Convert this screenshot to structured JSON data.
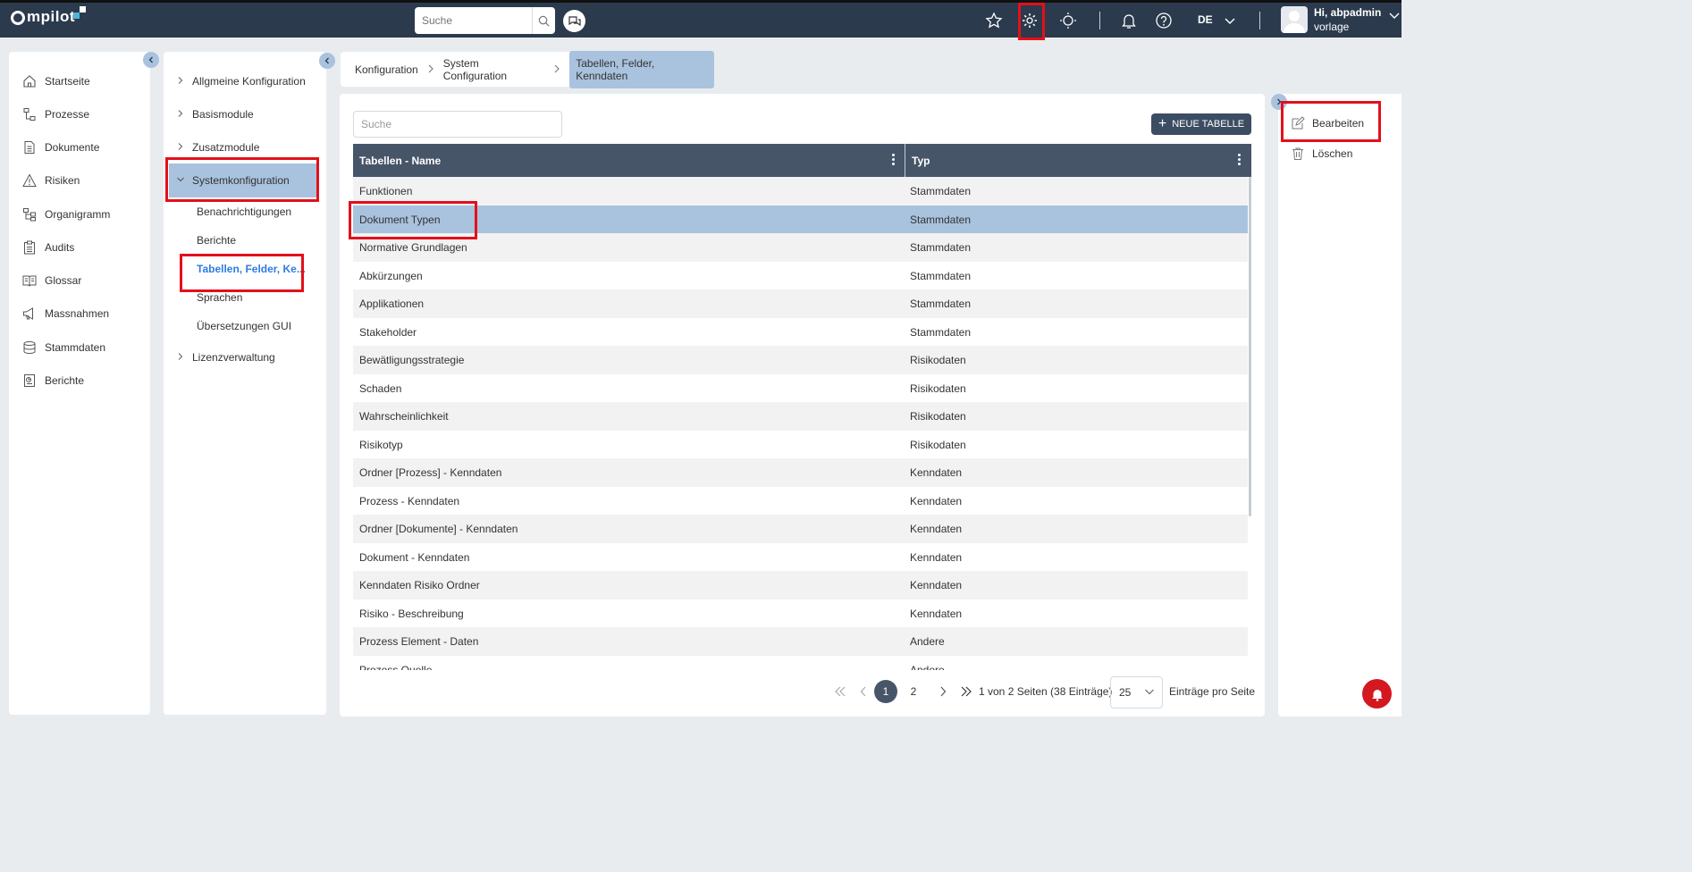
{
  "app": {
    "logo_text": "mpilot"
  },
  "topbar": {
    "search_placeholder": "Suche",
    "language": "DE",
    "user_greeting": "Hi, abpadmin",
    "user_sub": "vorlage"
  },
  "leftnav": {
    "items": [
      {
        "label": "Startseite",
        "icon": "home-icon"
      },
      {
        "label": "Prozesse",
        "icon": "process-icon"
      },
      {
        "label": "Dokumente",
        "icon": "document-icon"
      },
      {
        "label": "Risiken",
        "icon": "warning-icon"
      },
      {
        "label": "Organigramm",
        "icon": "orgchart-icon"
      },
      {
        "label": "Audits",
        "icon": "clipboard-icon"
      },
      {
        "label": "Glossar",
        "icon": "book-icon"
      },
      {
        "label": "Massnahmen",
        "icon": "megaphone-icon"
      },
      {
        "label": "Stammdaten",
        "icon": "database-icon"
      },
      {
        "label": "Berichte",
        "icon": "report-icon"
      }
    ]
  },
  "tree": {
    "nodes": [
      {
        "label": "Allgmeine Konfiguration"
      },
      {
        "label": "Basismodule"
      },
      {
        "label": "Zusatzmodule"
      },
      {
        "label": "Systemkonfiguration"
      }
    ],
    "children": [
      {
        "label": "Benachrichtigungen"
      },
      {
        "label": "Berichte"
      },
      {
        "label": "Tabellen, Felder, Ke..."
      },
      {
        "label": "Sprachen"
      },
      {
        "label": "Übersetzungen GUI"
      }
    ],
    "last_node": {
      "label": "Lizenzverwaltung"
    }
  },
  "breadcrumb": {
    "items": [
      "Konfiguration",
      "System Configuration",
      "Tabellen, Felder, Kenndaten"
    ]
  },
  "main": {
    "search_placeholder": "Suche",
    "new_button": "NEUE TABELLE",
    "columns": [
      "Tabellen - Name",
      "Typ"
    ],
    "rows": [
      [
        "Funktionen",
        "Stammdaten"
      ],
      [
        "Dokument Typen",
        "Stammdaten"
      ],
      [
        "Normative Grundlagen",
        "Stammdaten"
      ],
      [
        "Abkürzungen",
        "Stammdaten"
      ],
      [
        "Applikationen",
        "Stammdaten"
      ],
      [
        "Stakeholder",
        "Stammdaten"
      ],
      [
        "Bewätligungsstrategie",
        "Risikodaten"
      ],
      [
        "Schaden",
        "Risikodaten"
      ],
      [
        "Wahrscheinlichkeit",
        "Risikodaten"
      ],
      [
        "Risikotyp",
        "Risikodaten"
      ],
      [
        "Ordner [Prozess] - Kenndaten",
        "Kenndaten"
      ],
      [
        "Prozess - Kenndaten",
        "Kenndaten"
      ],
      [
        "Ordner [Dokumente] - Kenndaten",
        "Kenndaten"
      ],
      [
        "Dokument - Kenndaten",
        "Kenndaten"
      ],
      [
        "Kenndaten Risiko Ordner",
        "Kenndaten"
      ],
      [
        "Risiko - Beschreibung",
        "Kenndaten"
      ],
      [
        "Prozess Element - Daten",
        "Andere"
      ],
      [
        "Prozess Quelle",
        "Andere"
      ]
    ]
  },
  "pagination": {
    "pages": [
      "1",
      "2"
    ],
    "current": "1",
    "info": "1 von 2 Seiten (38 Einträge)",
    "page_size": "25",
    "page_size_label": "Einträge pro Seite"
  },
  "actions": {
    "edit": "Bearbeiten",
    "delete": "Löschen"
  },
  "colors": {
    "topbar": "#2b3a4d",
    "selected": "#a9c2de",
    "header": "#475569",
    "highlight": "#e3101a"
  }
}
